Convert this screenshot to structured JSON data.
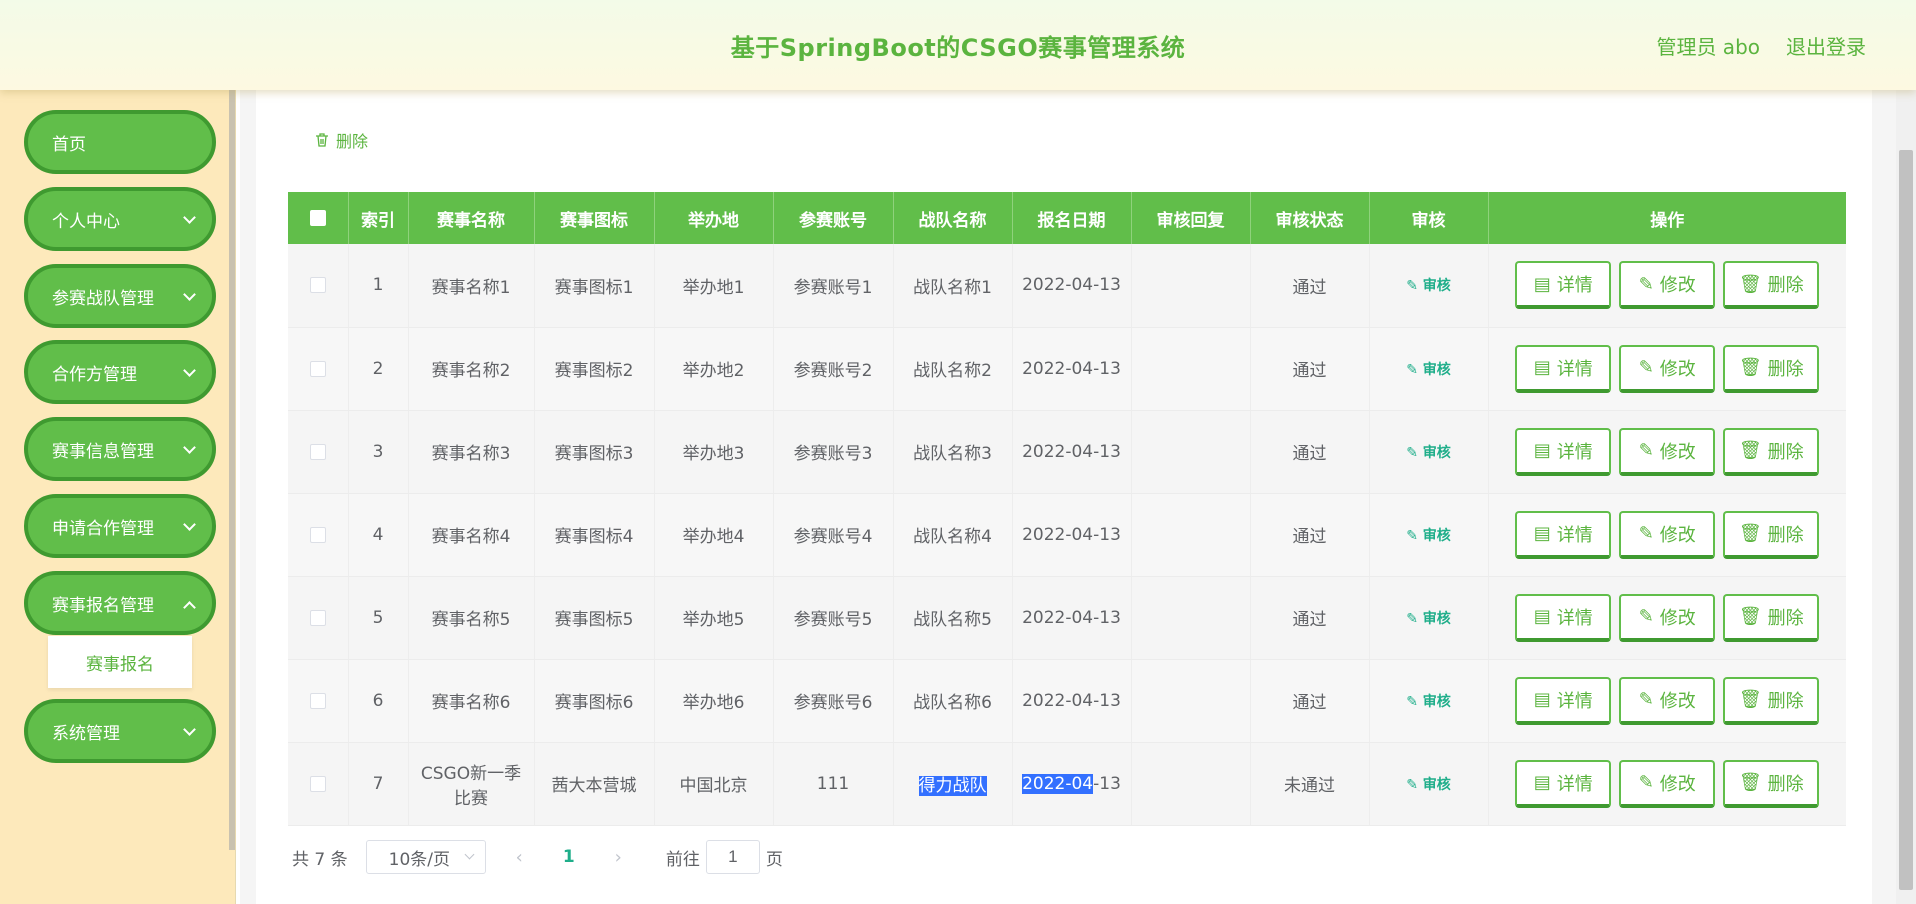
{
  "header": {
    "title": "基于SpringBoot的CSGO赛事管理系统",
    "user": "管理员 abo",
    "logout": "退出登录"
  },
  "sidebar": {
    "items": [
      {
        "label": "首页"
      },
      {
        "label": "个人中心"
      },
      {
        "label": "参赛战队管理"
      },
      {
        "label": "合作方管理"
      },
      {
        "label": "赛事信息管理"
      },
      {
        "label": "申请合作管理"
      },
      {
        "label": "赛事报名管理"
      },
      {
        "label": "系统管理"
      }
    ],
    "submenu": "赛事报名"
  },
  "toolbar": {
    "delete_label": "删除"
  },
  "table": {
    "headers": [
      "索引",
      "赛事名称",
      "赛事图标",
      "举办地",
      "参赛账号",
      "战队名称",
      "报名日期",
      "审核回复",
      "审核状态",
      "审核",
      "操作"
    ],
    "audit_label": "审核",
    "btn_detail": "详情",
    "btn_edit": "修改",
    "btn_delete": "删除",
    "rows": [
      {
        "index": "1",
        "name": "赛事名称1",
        "icon": "赛事图标1",
        "place": "举办地1",
        "account": "参赛账号1",
        "team": "战队名称1",
        "date": "2022-04-13",
        "reply": "",
        "status": "通过"
      },
      {
        "index": "2",
        "name": "赛事名称2",
        "icon": "赛事图标2",
        "place": "举办地2",
        "account": "参赛账号2",
        "team": "战队名称2",
        "date": "2022-04-13",
        "reply": "",
        "status": "通过"
      },
      {
        "index": "3",
        "name": "赛事名称3",
        "icon": "赛事图标3",
        "place": "举办地3",
        "account": "参赛账号3",
        "team": "战队名称3",
        "date": "2022-04-13",
        "reply": "",
        "status": "通过"
      },
      {
        "index": "4",
        "name": "赛事名称4",
        "icon": "赛事图标4",
        "place": "举办地4",
        "account": "参赛账号4",
        "team": "战队名称4",
        "date": "2022-04-13",
        "reply": "",
        "status": "通过"
      },
      {
        "index": "5",
        "name": "赛事名称5",
        "icon": "赛事图标5",
        "place": "举办地5",
        "account": "参赛账号5",
        "team": "战队名称5",
        "date": "2022-04-13",
        "reply": "",
        "status": "通过"
      },
      {
        "index": "6",
        "name": "赛事名称6",
        "icon": "赛事图标6",
        "place": "举办地6",
        "account": "参赛账号6",
        "team": "战队名称6",
        "date": "2022-04-13",
        "reply": "",
        "status": "通过"
      },
      {
        "index": "7",
        "name": "CSGO新一季比赛",
        "icon": "茜大本营城",
        "place": "中国北京",
        "account": "111",
        "team": "得力战队",
        "date": "2022-04-13",
        "reply": "",
        "status": "未通过"
      }
    ]
  },
  "pager": {
    "total": "共 7 条",
    "page_size": "10条/页",
    "current_page": "1",
    "goto_label": "前往",
    "goto_value": "1",
    "page_suffix": "页"
  },
  "colors": {
    "primary": "#61be4a",
    "primary_dark": "#3f9a30",
    "sidebar_bg": "#fde9bb",
    "audit": "#1fae8a"
  }
}
